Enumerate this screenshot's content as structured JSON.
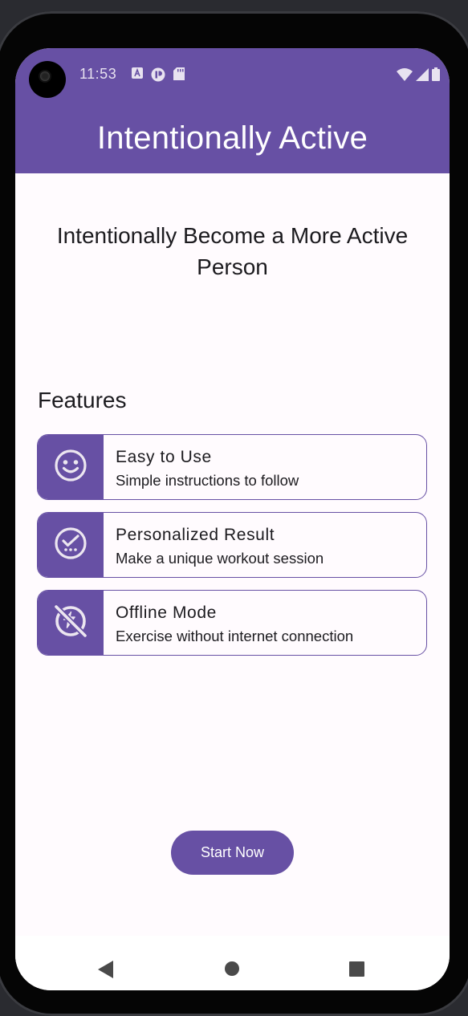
{
  "status_bar": {
    "time": "11:53",
    "left_icons": [
      "font-icon",
      "pause-circle-icon",
      "sd-card-icon"
    ],
    "right_icons": [
      "wifi-icon",
      "cellular-signal-icon",
      "battery-icon"
    ]
  },
  "app_bar": {
    "title": "Intentionally Active"
  },
  "main": {
    "headline": "Intentionally Become a More Active Person",
    "features_title": "Features",
    "features": [
      {
        "icon": "smile-icon",
        "title": "Easy to Use",
        "description": "Simple instructions to follow"
      },
      {
        "icon": "check-circle-icon",
        "title": "Personalized Result",
        "description": "Make a unique workout session"
      },
      {
        "icon": "offline-icon",
        "title": "Offline Mode",
        "description": "Exercise without internet connection"
      }
    ],
    "start_button_label": "Start Now"
  },
  "nav_bar": {
    "icons": [
      "back-icon",
      "home-icon",
      "recents-icon"
    ]
  },
  "colors": {
    "primary": "#6750a4",
    "surface": "#fffbfe",
    "on_surface": "#1c1b1f"
  }
}
